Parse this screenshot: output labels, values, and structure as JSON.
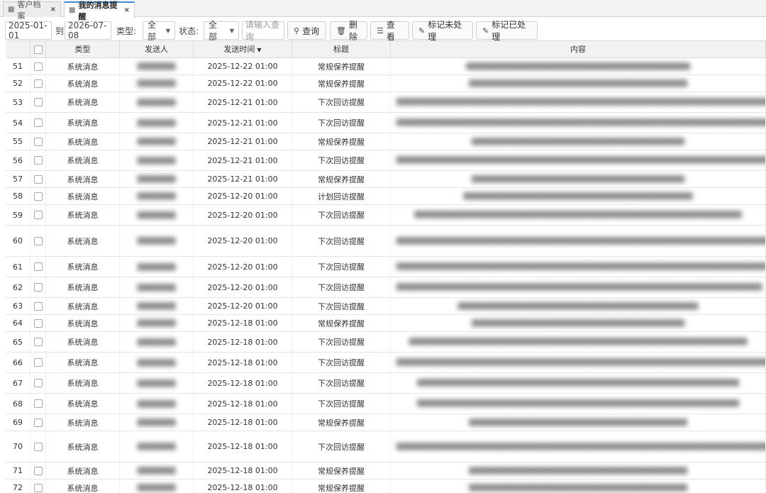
{
  "tabs": [
    {
      "label": "客户档案",
      "icon": "sitemap-icon"
    },
    {
      "label": "我的消息提醒",
      "icon": "sitemap-icon",
      "active": true
    }
  ],
  "filters": {
    "date_from": "2025-01-01",
    "to_label": "到",
    "date_to": "2026-07-08",
    "type_label": "类型:",
    "type_value": "全部",
    "status_label": "状态:",
    "status_value": "全部",
    "search_placeholder": "请输入查询"
  },
  "buttons": {
    "query": "查询",
    "delete": "删除",
    "view": "查看",
    "mark_unprocessed": "标记未处理",
    "mark_processed": "标记已处理"
  },
  "table": {
    "columns": [
      "类型",
      "发送人",
      "发送时间",
      "标题",
      "内容"
    ],
    "rows": [
      {
        "num": "51",
        "type": "系统消息",
        "sender": "▇▇▇▇▇▇▇",
        "time": "2025-12-22 01:00",
        "title": "常规保养提醒",
        "content": "▇▇▇▇▇▇▇▇▇▇▇▇▇▇▇▇▇▇▇▇▇▇▇▇▇▇▇▇▇▇▇▇▇▇▇▇▇▇▇▇▇"
      },
      {
        "num": "52",
        "type": "系统消息",
        "sender": "▇▇▇▇▇▇▇",
        "time": "2025-12-22 01:00",
        "title": "常规保养提醒",
        "content": "▇▇▇▇▇▇▇▇▇▇▇▇▇▇▇▇▇▇▇▇▇▇▇▇▇▇▇▇▇▇▇▇▇▇▇▇▇▇▇▇"
      },
      {
        "num": "53",
        "type": "系统消息",
        "sender": "▇▇▇▇▇▇▇",
        "time": "2025-12-21 01:00",
        "title": "下次回访提醒",
        "content": "▇▇▇▇▇▇▇▇▇▇▇▇▇▇▇▇▇▇▇▇▇▇▇▇▇▇▇▇▇▇▇▇▇▇▇▇▇▇▇▇▇▇▇▇▇▇▇▇▇▇▇▇▇▇▇▇▇▇▇▇▇▇▇▇▇▇▇▇▇▇▇▇▇▇▇▇▇▇▇▇▇▇"
      },
      {
        "num": "54",
        "type": "系统消息",
        "sender": "▇▇▇▇▇▇▇",
        "time": "2025-12-21 01:00",
        "title": "下次回访提醒",
        "content": "▇▇▇▇▇▇▇▇▇▇▇▇▇▇▇▇▇▇▇▇▇▇▇▇▇▇▇▇▇▇▇▇▇▇▇▇▇▇▇▇▇▇▇▇▇▇▇▇▇▇▇▇▇▇▇▇▇▇▇▇▇▇▇▇▇▇▇▇▇▇▇▇▇▇▇"
      },
      {
        "num": "55",
        "type": "系统消息",
        "sender": "▇▇▇▇▇▇▇",
        "time": "2025-12-21 01:00",
        "title": "常规保养提醒",
        "content": "▇▇▇▇▇▇▇▇▇▇▇▇▇▇▇▇▇▇▇▇▇▇▇▇▇▇▇▇▇▇▇▇▇▇▇▇▇▇▇"
      },
      {
        "num": "56",
        "type": "系统消息",
        "sender": "▇▇▇▇▇▇▇",
        "time": "2025-12-21 01:00",
        "title": "下次回访提醒",
        "content": "▇▇▇▇▇▇▇▇▇▇▇▇▇▇▇▇▇▇▇▇▇▇▇▇▇▇▇▇▇▇▇▇▇▇▇▇▇▇▇▇▇▇▇▇▇▇▇▇▇▇▇▇▇▇▇▇▇▇▇▇▇▇▇▇▇▇▇▇▇▇▇▇▇▇▇▇▇"
      },
      {
        "num": "57",
        "type": "系统消息",
        "sender": "▇▇▇▇▇▇▇",
        "time": "2025-12-21 01:00",
        "title": "常规保养提醒",
        "content": "▇▇▇▇▇▇▇▇▇▇▇▇▇▇▇▇▇▇▇▇▇▇▇▇▇▇▇▇▇▇▇▇▇▇▇▇▇▇▇"
      },
      {
        "num": "58",
        "type": "系统消息",
        "sender": "▇▇▇▇▇▇▇",
        "time": "2025-12-20 01:00",
        "title": "计划回访提醒",
        "content": "▇▇▇▇▇▇▇▇▇▇▇▇▇▇▇▇▇▇▇▇▇▇▇▇▇▇▇▇▇▇▇▇▇▇▇▇▇▇▇▇▇▇"
      },
      {
        "num": "59",
        "type": "系统消息",
        "sender": "▇▇▇▇▇▇▇",
        "time": "2025-12-20 01:00",
        "title": "下次回访提醒",
        "content": "▇▇▇▇▇▇▇▇▇▇▇▇▇▇▇▇▇▇▇▇▇▇▇▇▇▇▇▇▇▇▇▇▇▇▇▇▇▇▇▇▇▇▇▇▇▇▇▇▇▇▇▇▇▇▇▇▇▇▇▇"
      },
      {
        "num": "60",
        "type": "系统消息",
        "sender": "▇▇▇▇▇▇▇",
        "time": "2025-12-20 01:00",
        "title": "下次回访提醒",
        "content": "▇▇▇▇▇▇▇▇▇▇▇▇▇▇▇▇▇▇▇▇▇▇▇▇▇▇▇▇▇▇▇▇▇▇▇▇▇▇▇▇▇▇▇▇▇▇▇▇▇▇▇▇▇▇▇▇▇▇▇▇▇▇▇▇▇▇▇▇▇▇▇▇▇▇▇▇▇▇▇▇▇▇▇▇▇▇▇▇▇▇▇▇▇▇▇▇▇▇▇▇▇▇▇▇▇▇▇▇▇▇▇▇▇▇▇▇▇▇▇▇▇▇"
      },
      {
        "num": "61",
        "type": "系统消息",
        "sender": "▇▇▇▇▇▇▇",
        "time": "2025-12-20 01:00",
        "title": "下次回访提醒",
        "content": "▇▇▇▇▇▇▇▇▇▇▇▇▇▇▇▇▇▇▇▇▇▇▇▇▇▇▇▇▇▇▇▇▇▇▇▇▇▇▇▇▇▇▇▇▇▇▇▇▇▇▇▇▇▇▇▇▇▇▇▇▇▇▇▇▇▇▇▇"
      },
      {
        "num": "62",
        "type": "系统消息",
        "sender": "▇▇▇▇▇▇▇",
        "time": "2025-12-20 01:00",
        "title": "下次回访提醒",
        "content": "▇▇▇▇▇▇▇▇▇▇▇▇▇▇▇▇▇▇▇▇▇▇▇▇▇▇▇▇▇▇▇▇▇▇▇▇▇▇▇▇▇▇▇▇▇▇▇▇▇▇▇▇▇▇▇▇▇▇▇▇▇▇▇▇▇▇▇"
      },
      {
        "num": "63",
        "type": "系统消息",
        "sender": "▇▇▇▇▇▇▇",
        "time": "2025-12-20 01:00",
        "title": "下次回访提醒",
        "content": "▇▇▇▇▇▇▇▇▇▇▇▇▇▇▇▇▇▇▇▇▇▇▇▇▇▇▇▇▇▇▇▇▇▇▇▇▇▇▇▇▇▇▇▇"
      },
      {
        "num": "64",
        "type": "系统消息",
        "sender": "▇▇▇▇▇▇▇",
        "time": "2025-12-18 01:00",
        "title": "常规保养提醒",
        "content": "▇▇▇▇▇▇▇▇▇▇▇▇▇▇▇▇▇▇▇▇▇▇▇▇▇▇▇▇▇▇▇▇▇▇▇▇▇▇▇"
      },
      {
        "num": "65",
        "type": "系统消息",
        "sender": "▇▇▇▇▇▇▇",
        "time": "2025-12-18 01:00",
        "title": "下次回访提醒",
        "content": "▇▇▇▇▇▇▇▇▇▇▇▇▇▇▇▇▇▇▇▇▇▇▇▇▇▇▇▇▇▇▇▇▇▇▇▇▇▇▇▇▇▇▇▇▇▇▇▇▇▇▇▇▇▇▇▇▇▇▇▇▇▇"
      },
      {
        "num": "66",
        "type": "系统消息",
        "sender": "▇▇▇▇▇▇▇",
        "time": "2025-12-18 01:00",
        "title": "下次回访提醒",
        "content": "▇▇▇▇▇▇▇▇▇▇▇▇▇▇▇▇▇▇▇▇▇▇▇▇▇▇▇▇▇▇▇▇▇▇▇▇▇▇▇▇▇▇▇▇▇▇▇▇▇▇▇▇▇▇▇▇▇▇▇▇▇▇▇▇▇▇▇▇▇▇▇▇▇▇▇▇"
      },
      {
        "num": "67",
        "type": "系统消息",
        "sender": "▇▇▇▇▇▇▇",
        "time": "2025-12-18 01:00",
        "title": "下次回访提醒",
        "content": "▇▇▇▇▇▇▇▇▇▇▇▇▇▇▇▇▇▇▇▇▇▇▇▇▇▇▇▇▇▇▇▇▇▇▇▇▇▇▇▇▇▇▇▇▇▇▇▇▇▇▇▇▇▇▇▇▇▇▇"
      },
      {
        "num": "68",
        "type": "系统消息",
        "sender": "▇▇▇▇▇▇▇",
        "time": "2025-12-18 01:00",
        "title": "下次回访提醒",
        "content": "▇▇▇▇▇▇▇▇▇▇▇▇▇▇▇▇▇▇▇▇▇▇▇▇▇▇▇▇▇▇▇▇▇▇▇▇▇▇▇▇▇▇▇▇▇▇▇▇▇▇▇▇▇▇▇▇▇▇▇"
      },
      {
        "num": "69",
        "type": "系统消息",
        "sender": "▇▇▇▇▇▇▇",
        "time": "2025-12-18 01:00",
        "title": "常规保养提醒",
        "content": "▇▇▇▇▇▇▇▇▇▇▇▇▇▇▇▇▇▇▇▇▇▇▇▇▇▇▇▇▇▇▇▇▇▇▇▇▇▇▇▇"
      },
      {
        "num": "70",
        "type": "系统消息",
        "sender": "▇▇▇▇▇▇▇",
        "time": "2025-12-18 01:00",
        "title": "下次回访提醒",
        "content": "▇▇▇▇▇▇▇▇▇▇▇▇▇▇▇▇▇▇▇▇▇▇▇▇▇▇▇▇▇▇▇▇▇▇▇▇▇▇▇▇▇▇▇▇▇▇▇▇▇▇▇▇▇▇▇▇▇▇▇▇▇▇▇▇▇▇▇▇▇▇▇▇▇▇▇▇▇▇▇▇▇▇▇▇▇▇▇▇▇▇▇▇▇▇▇▇▇▇▇▇▇▇▇▇▇▇▇"
      },
      {
        "num": "71",
        "type": "系统消息",
        "sender": "▇▇▇▇▇▇▇",
        "time": "2025-12-18 01:00",
        "title": "常规保养提醒",
        "content": "▇▇▇▇▇▇▇▇▇▇▇▇▇▇▇▇▇▇▇▇▇▇▇▇▇▇▇▇▇▇▇▇▇▇▇▇▇▇▇▇"
      },
      {
        "num": "72",
        "type": "系统消息",
        "sender": "▇▇▇▇▇▇▇",
        "time": "2025-12-18 01:00",
        "title": "常规保养提醒",
        "content": "▇▇▇▇▇▇▇▇▇▇▇▇▇▇▇▇▇▇▇▇▇▇▇▇▇▇▇▇▇▇▇▇▇▇▇▇▇▇▇▇"
      }
    ]
  },
  "colors": {
    "accent": "#3a8ee6",
    "header_bg": "#f2f2f2"
  }
}
